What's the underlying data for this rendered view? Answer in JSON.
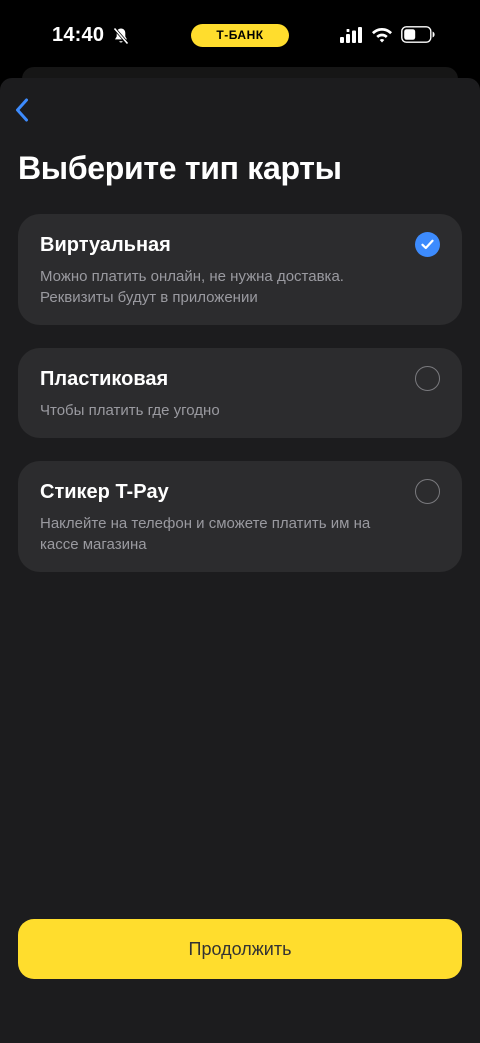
{
  "status_bar": {
    "time": "14:40",
    "carrier_badge": "Т-БАНК",
    "icons": [
      "bell-slash-icon",
      "signal-icon",
      "wifi-icon",
      "battery-icon"
    ]
  },
  "header": {
    "back_icon": "chevron-left-icon",
    "title": "Выберите тип карты"
  },
  "options": [
    {
      "title": "Виртуальная",
      "description": "Можно платить онлайн, не нужна доставка. Реквизиты будут в приложении",
      "selected": true
    },
    {
      "title": "Пластиковая",
      "description": "Чтобы платить где угодно",
      "selected": false
    },
    {
      "title": "Стикер T-Pay",
      "description": "Наклейте на телефон и сможете платить им на кассе магазина",
      "selected": false
    }
  ],
  "continue_button": {
    "label": "Продолжить"
  },
  "colors": {
    "accent_yellow": "#ffdd2d",
    "selected_blue": "#3d8bfd",
    "card_bg": "#2c2c2e",
    "sheet_bg": "#1c1c1e"
  }
}
